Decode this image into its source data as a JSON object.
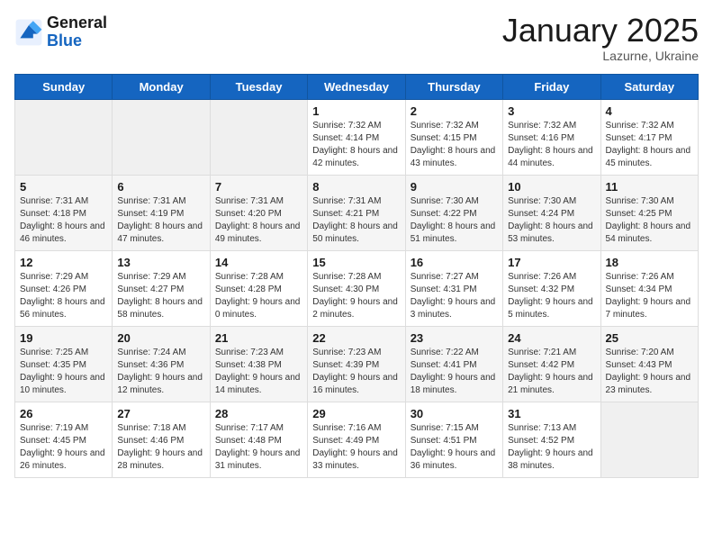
{
  "header": {
    "logo_line1": "General",
    "logo_line2": "Blue",
    "month": "January 2025",
    "location": "Lazurne, Ukraine"
  },
  "days_of_week": [
    "Sunday",
    "Monday",
    "Tuesday",
    "Wednesday",
    "Thursday",
    "Friday",
    "Saturday"
  ],
  "weeks": [
    [
      {
        "day": null
      },
      {
        "day": null
      },
      {
        "day": null
      },
      {
        "day": "1",
        "sunrise": "7:32 AM",
        "sunset": "4:14 PM",
        "daylight": "8 hours and 42 minutes."
      },
      {
        "day": "2",
        "sunrise": "7:32 AM",
        "sunset": "4:15 PM",
        "daylight": "8 hours and 43 minutes."
      },
      {
        "day": "3",
        "sunrise": "7:32 AM",
        "sunset": "4:16 PM",
        "daylight": "8 hours and 44 minutes."
      },
      {
        "day": "4",
        "sunrise": "7:32 AM",
        "sunset": "4:17 PM",
        "daylight": "8 hours and 45 minutes."
      }
    ],
    [
      {
        "day": "5",
        "sunrise": "7:31 AM",
        "sunset": "4:18 PM",
        "daylight": "8 hours and 46 minutes."
      },
      {
        "day": "6",
        "sunrise": "7:31 AM",
        "sunset": "4:19 PM",
        "daylight": "8 hours and 47 minutes."
      },
      {
        "day": "7",
        "sunrise": "7:31 AM",
        "sunset": "4:20 PM",
        "daylight": "8 hours and 49 minutes."
      },
      {
        "day": "8",
        "sunrise": "7:31 AM",
        "sunset": "4:21 PM",
        "daylight": "8 hours and 50 minutes."
      },
      {
        "day": "9",
        "sunrise": "7:30 AM",
        "sunset": "4:22 PM",
        "daylight": "8 hours and 51 minutes."
      },
      {
        "day": "10",
        "sunrise": "7:30 AM",
        "sunset": "4:24 PM",
        "daylight": "8 hours and 53 minutes."
      },
      {
        "day": "11",
        "sunrise": "7:30 AM",
        "sunset": "4:25 PM",
        "daylight": "8 hours and 54 minutes."
      }
    ],
    [
      {
        "day": "12",
        "sunrise": "7:29 AM",
        "sunset": "4:26 PM",
        "daylight": "8 hours and 56 minutes."
      },
      {
        "day": "13",
        "sunrise": "7:29 AM",
        "sunset": "4:27 PM",
        "daylight": "8 hours and 58 minutes."
      },
      {
        "day": "14",
        "sunrise": "7:28 AM",
        "sunset": "4:28 PM",
        "daylight": "9 hours and 0 minutes."
      },
      {
        "day": "15",
        "sunrise": "7:28 AM",
        "sunset": "4:30 PM",
        "daylight": "9 hours and 2 minutes."
      },
      {
        "day": "16",
        "sunrise": "7:27 AM",
        "sunset": "4:31 PM",
        "daylight": "9 hours and 3 minutes."
      },
      {
        "day": "17",
        "sunrise": "7:26 AM",
        "sunset": "4:32 PM",
        "daylight": "9 hours and 5 minutes."
      },
      {
        "day": "18",
        "sunrise": "7:26 AM",
        "sunset": "4:34 PM",
        "daylight": "9 hours and 7 minutes."
      }
    ],
    [
      {
        "day": "19",
        "sunrise": "7:25 AM",
        "sunset": "4:35 PM",
        "daylight": "9 hours and 10 minutes."
      },
      {
        "day": "20",
        "sunrise": "7:24 AM",
        "sunset": "4:36 PM",
        "daylight": "9 hours and 12 minutes."
      },
      {
        "day": "21",
        "sunrise": "7:23 AM",
        "sunset": "4:38 PM",
        "daylight": "9 hours and 14 minutes."
      },
      {
        "day": "22",
        "sunrise": "7:23 AM",
        "sunset": "4:39 PM",
        "daylight": "9 hours and 16 minutes."
      },
      {
        "day": "23",
        "sunrise": "7:22 AM",
        "sunset": "4:41 PM",
        "daylight": "9 hours and 18 minutes."
      },
      {
        "day": "24",
        "sunrise": "7:21 AM",
        "sunset": "4:42 PM",
        "daylight": "9 hours and 21 minutes."
      },
      {
        "day": "25",
        "sunrise": "7:20 AM",
        "sunset": "4:43 PM",
        "daylight": "9 hours and 23 minutes."
      }
    ],
    [
      {
        "day": "26",
        "sunrise": "7:19 AM",
        "sunset": "4:45 PM",
        "daylight": "9 hours and 26 minutes."
      },
      {
        "day": "27",
        "sunrise": "7:18 AM",
        "sunset": "4:46 PM",
        "daylight": "9 hours and 28 minutes."
      },
      {
        "day": "28",
        "sunrise": "7:17 AM",
        "sunset": "4:48 PM",
        "daylight": "9 hours and 31 minutes."
      },
      {
        "day": "29",
        "sunrise": "7:16 AM",
        "sunset": "4:49 PM",
        "daylight": "9 hours and 33 minutes."
      },
      {
        "day": "30",
        "sunrise": "7:15 AM",
        "sunset": "4:51 PM",
        "daylight": "9 hours and 36 minutes."
      },
      {
        "day": "31",
        "sunrise": "7:13 AM",
        "sunset": "4:52 PM",
        "daylight": "9 hours and 38 minutes."
      },
      {
        "day": null
      }
    ]
  ],
  "daylight_label": "Daylight:",
  "sunrise_label": "Sunrise:",
  "sunset_label": "Sunset:"
}
